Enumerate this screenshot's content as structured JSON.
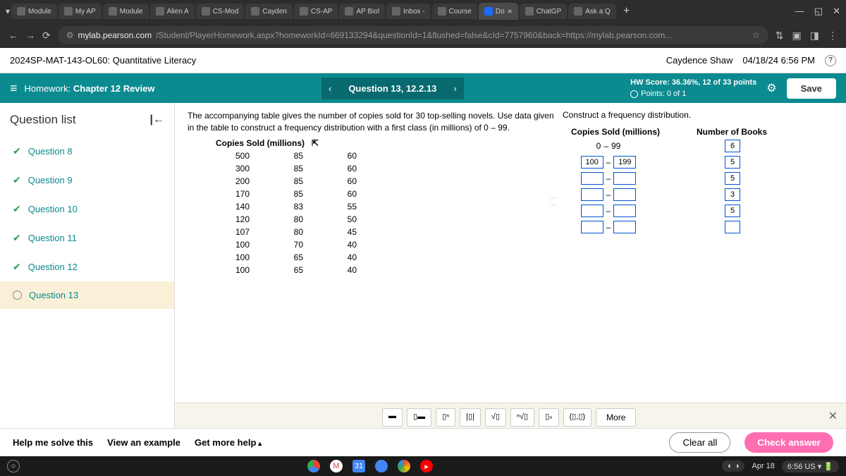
{
  "browser": {
    "tabs": [
      "Module",
      "My AP",
      "Module",
      "Alien A",
      "CS-Mod",
      "Cayden",
      "CS-AP",
      "AP Biol",
      "Inbox -",
      "Course",
      "Do",
      "ChatGP",
      "Ask a Q"
    ],
    "active_tab_index": 10,
    "url_prefix": "mylab.pearson.com",
    "url_rest": "/Student/PlayerHomework.aspx?homeworkId=669133294&questionId=1&flushed=false&cId=7757960&back=https://mylab.pearson.com..."
  },
  "course": {
    "title": "2024SP-MAT-143-OL60: Quantitative Literacy",
    "student": "Caydence Shaw",
    "datetime": "04/18/24 6:56 PM"
  },
  "hwbar": {
    "label": "Homework:",
    "title": "Chapter 12 Review",
    "question_label": "Question 13, 12.2.13",
    "score_line": "HW Score: 36.36%, 12 of 33 points",
    "points_line": "Points: 0 of 1",
    "save": "Save"
  },
  "sidebar": {
    "header": "Question list",
    "items": [
      {
        "label": "Question 8",
        "done": true
      },
      {
        "label": "Question 9",
        "done": true
      },
      {
        "label": "Question 10",
        "done": true
      },
      {
        "label": "Question 11",
        "done": true
      },
      {
        "label": "Question 12",
        "done": true
      },
      {
        "label": "Question 13",
        "done": false,
        "active": true
      }
    ]
  },
  "content": {
    "instruction": "The accompanying table gives the number of copies sold for 30 top-selling novels. Use data given in the table to construct a frequency distribution with a first class (in millions) of 0 – 99.",
    "table_header": "Copies Sold (millions)",
    "table": [
      [
        "500",
        "85",
        "60"
      ],
      [
        "300",
        "85",
        "60"
      ],
      [
        "200",
        "85",
        "60"
      ],
      [
        "170",
        "85",
        "60"
      ],
      [
        "140",
        "83",
        "55"
      ],
      [
        "120",
        "80",
        "50"
      ],
      [
        "107",
        "80",
        "45"
      ],
      [
        "100",
        "70",
        "40"
      ],
      [
        "100",
        "65",
        "40"
      ],
      [
        "100",
        "65",
        "40"
      ]
    ]
  },
  "distribution": {
    "prompt": "Construct a frequency distribution.",
    "col1": "Copies Sold (millions)",
    "col2": "Number of Books",
    "rows": [
      {
        "low": "0",
        "dash": "–",
        "high": "99",
        "fixed": true,
        "count": "6"
      },
      {
        "low": "100",
        "high": "199",
        "count": "5"
      },
      {
        "low": "",
        "high": "",
        "count": "5"
      },
      {
        "low": "",
        "high": "",
        "count": "3"
      },
      {
        "low": "",
        "high": "",
        "count": "5"
      },
      {
        "low": "",
        "high": "",
        "count": ""
      }
    ]
  },
  "toolbar": {
    "more": "More"
  },
  "footer": {
    "help": "Help me solve this",
    "example": "View an example",
    "morehelp": "Get more help",
    "clear": "Clear all",
    "check": "Check answer"
  },
  "taskbar": {
    "date": "Apr 18",
    "time": "6:56 US"
  }
}
